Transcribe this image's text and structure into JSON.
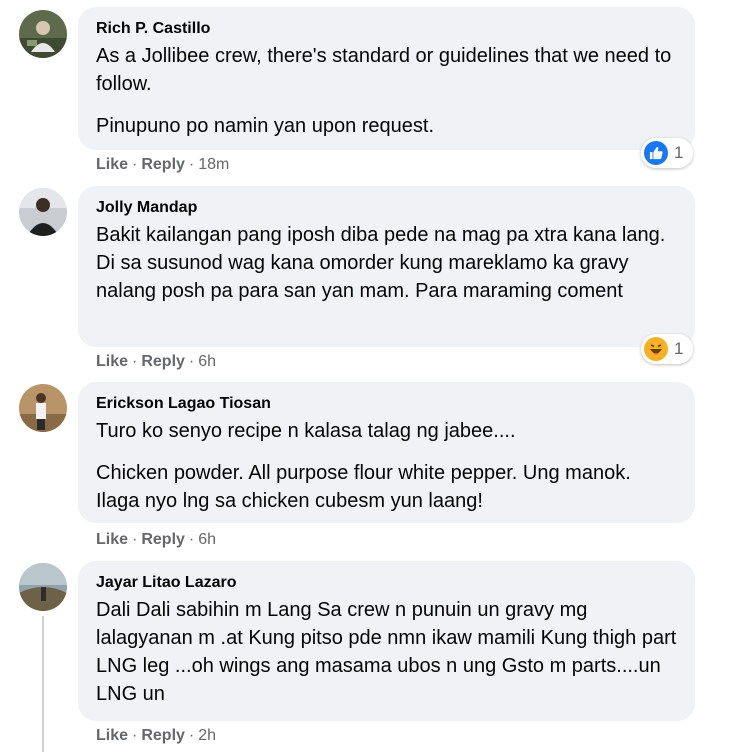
{
  "comments": [
    {
      "author": "Rich P. Castillo",
      "paragraphs": [
        "As a Jollibee crew, there's standard or guidelines that we need to follow.",
        "Pinupuno po namin yan upon request."
      ],
      "like_label": "Like",
      "reply_label": "Reply",
      "time": "18m",
      "reaction": {
        "icon": "like-icon",
        "count": "1",
        "color": "#1877f2"
      }
    },
    {
      "author": "Jolly Mandap",
      "paragraphs": [
        "Bakit kailangan pang iposh diba pede na mag pa xtra kana lang. Di sa susunod wag kana omorder kung mareklamo ka gravy nalang posh pa para san yan mam. Para maraming coment"
      ],
      "like_label": "Like",
      "reply_label": "Reply",
      "time": "6h",
      "reaction": {
        "icon": "haha-icon",
        "count": "1",
        "color": "#f7b125"
      }
    },
    {
      "author": "Erickson Lagao Tiosan",
      "paragraphs": [
        "Turo ko senyo recipe n kalasa talag ng jabee....",
        "Chicken powder. All purpose flour white pepper. Ung manok. Ilaga nyo lng sa chicken cubesm yun laang!"
      ],
      "like_label": "Like",
      "reply_label": "Reply",
      "time": "6h"
    },
    {
      "author": "Jayar Litao Lazaro",
      "paragraphs": [
        "Dali Dali sabihin m Lang Sa crew n punuin un gravy mg lalagyanan m .at Kung pitso pde nmn ikaw mamili Kung thigh part LNG leg ...oh wings ang masama ubos n ung Gsto m parts....un LNG un"
      ],
      "like_label": "Like",
      "reply_label": "Reply",
      "time": "2h"
    }
  ],
  "separator": "·"
}
